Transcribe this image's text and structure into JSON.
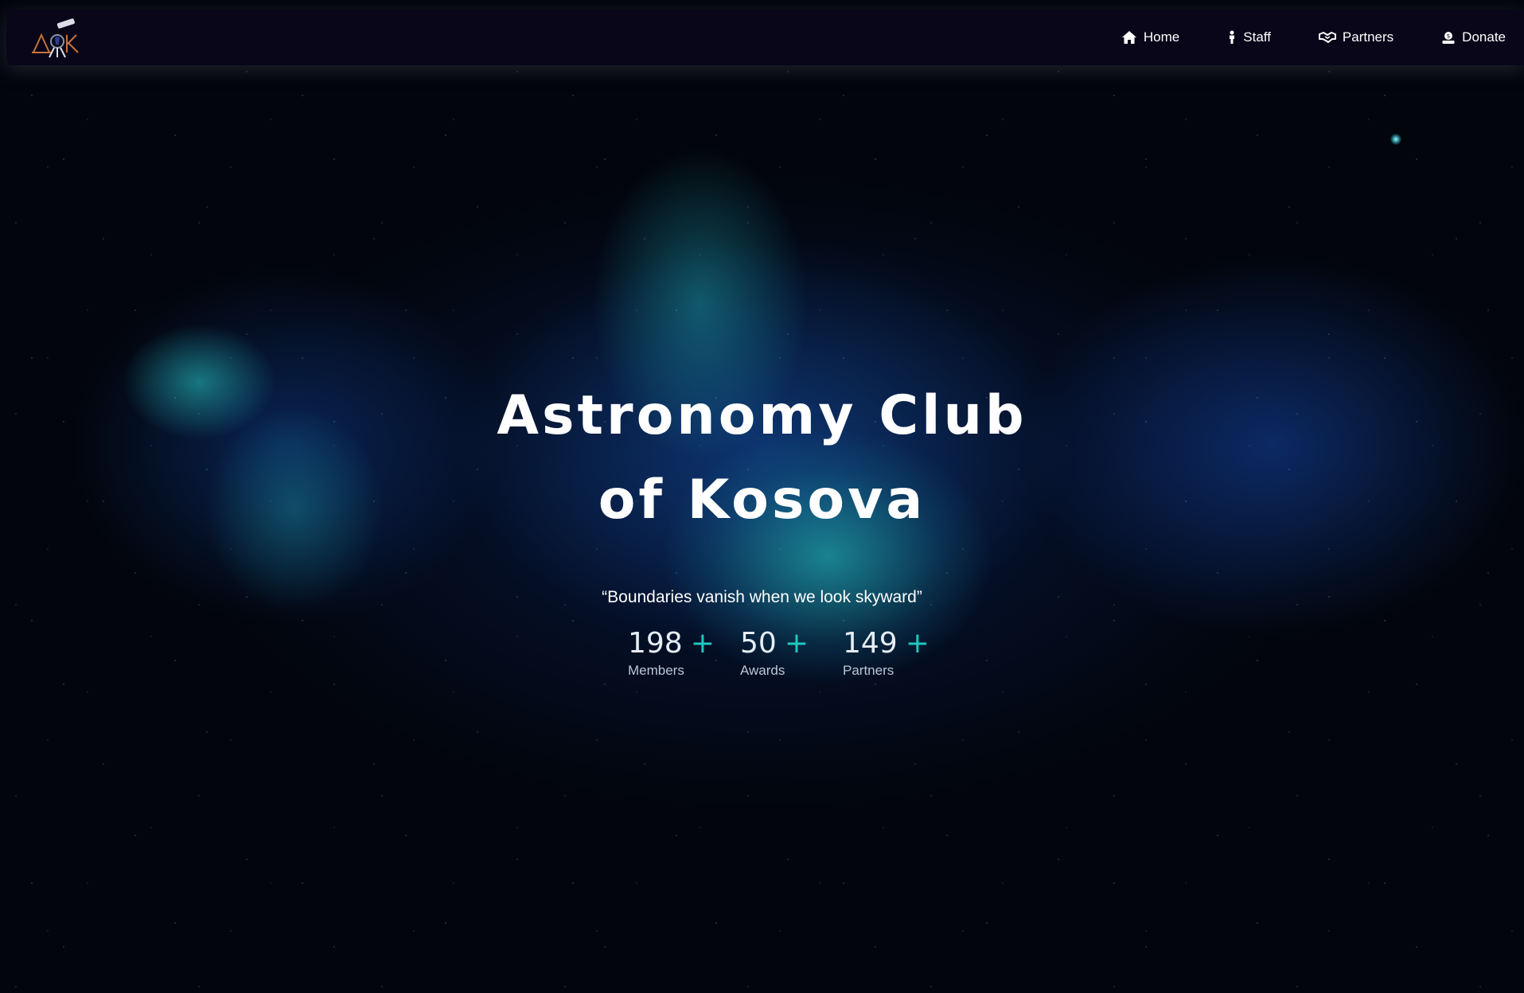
{
  "nav": {
    "logo_icon": "telescope-logo-icon",
    "items": [
      {
        "label": "Home",
        "icon": "home-icon"
      },
      {
        "label": "Staff",
        "icon": "person-icon"
      },
      {
        "label": "Partners",
        "icon": "handshake-icon"
      },
      {
        "label": "Donate",
        "icon": "donate-icon"
      }
    ]
  },
  "hero": {
    "title_line1": "Astronomy Club",
    "title_line2": "of Kosova",
    "quote": "“Boundaries vanish when we look skyward”",
    "stats": [
      {
        "number": "198",
        "plus": "+",
        "label": "Members"
      },
      {
        "number": "50",
        "plus": "+",
        "label": "Awards"
      },
      {
        "number": "149",
        "plus": "+",
        "label": "Partners"
      }
    ]
  },
  "colors": {
    "navbar_bg": "#080618",
    "accent": "#1fc7c0",
    "text": "#ffffff"
  }
}
